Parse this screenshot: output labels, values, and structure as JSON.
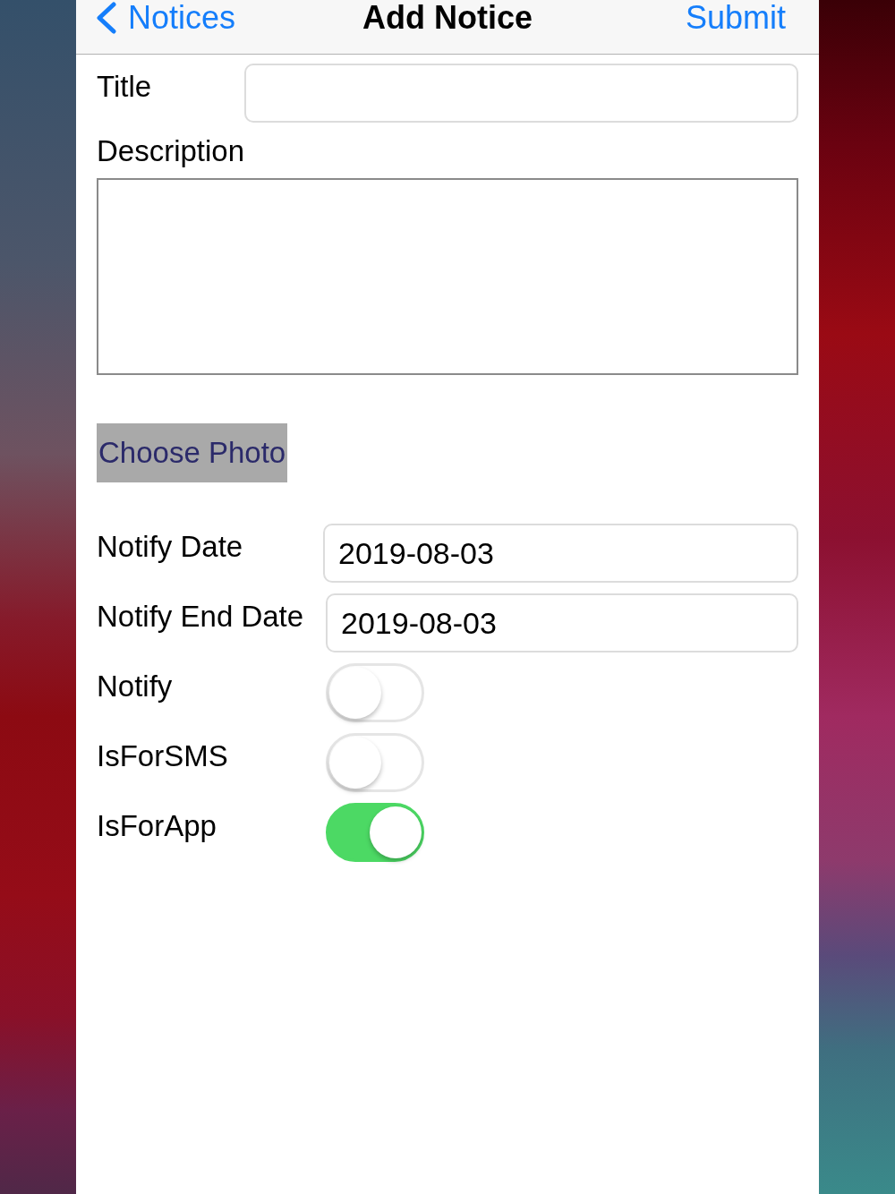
{
  "nav_bar": {
    "back_label": "Notices",
    "title": "Add Notice",
    "action_label": "Submit"
  },
  "form": [
    {
      "kind": "text",
      "label": "Title"
    },
    {
      "kind": "textarea",
      "label": "Description"
    },
    {
      "kind": "button",
      "label": "Choose Photo"
    },
    {
      "kind": "date",
      "label": "Notify Date",
      "value": "2019-08-03"
    },
    {
      "kind": "date",
      "label": "Notify End Date",
      "value": "2019-08-03"
    },
    {
      "kind": "switch",
      "label": "Notify",
      "on": false
    },
    {
      "kind": "switch",
      "label": "IsForSMS",
      "on": false
    },
    {
      "kind": "switch",
      "label": "IsForApp",
      "on": true
    }
  ]
}
